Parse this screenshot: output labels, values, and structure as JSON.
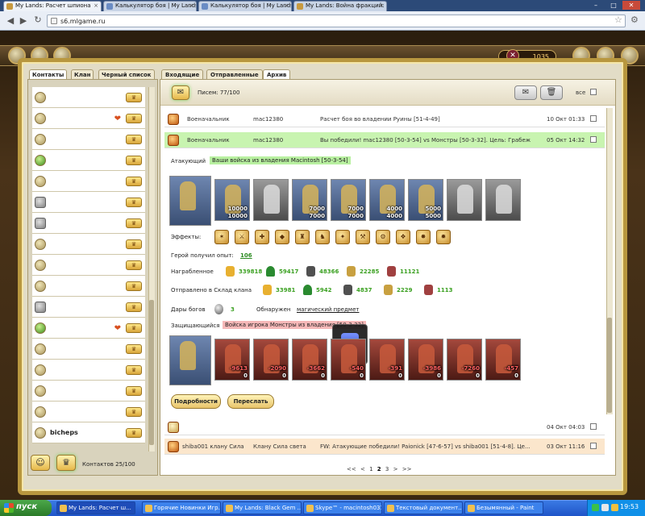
{
  "browser": {
    "tabs": [
      {
        "label": "My Lands: Расчет шпиона",
        "active": true
      },
      {
        "label": "Калькулятор боя | My Lands"
      },
      {
        "label": "Калькулятор боя | My Lands"
      },
      {
        "label": "My Lands: Война фракций: С"
      }
    ],
    "url": "s6.mlgame.ru",
    "controls": {
      "min": "–",
      "max": "□",
      "close": "✕"
    }
  },
  "game_top": {
    "resource_value": "1035"
  },
  "left_tabs": [
    "Контакты",
    "Клан",
    "Черный список"
  ],
  "contacts": [
    {
      "avatar": "plain",
      "name": "",
      "heart": false
    },
    {
      "avatar": "plain",
      "name": "",
      "heart": true
    },
    {
      "avatar": "plain",
      "name": "",
      "heart": false
    },
    {
      "avatar": "green",
      "name": "",
      "heart": false
    },
    {
      "avatar": "plain",
      "name": "",
      "heart": false
    },
    {
      "avatar": "lock",
      "name": "",
      "heart": false
    },
    {
      "avatar": "lock",
      "name": "",
      "heart": false
    },
    {
      "avatar": "plain",
      "name": "",
      "heart": false
    },
    {
      "avatar": "plain",
      "name": "",
      "heart": false
    },
    {
      "avatar": "plain",
      "name": "",
      "heart": false
    },
    {
      "avatar": "lock",
      "name": "",
      "heart": false
    },
    {
      "avatar": "green",
      "name": "",
      "heart": true
    },
    {
      "avatar": "plain",
      "name": "",
      "heart": false
    },
    {
      "avatar": "plain",
      "name": "",
      "heart": false
    },
    {
      "avatar": "plain",
      "name": "",
      "heart": false
    },
    {
      "avatar": "plain",
      "name": "",
      "heart": false
    },
    {
      "avatar": "plain",
      "name": "bicheps",
      "heart": false
    }
  ],
  "contacts_footer": {
    "count_label": "Контактов 25/100"
  },
  "right_tabs": [
    "Входящие",
    "Отправленные",
    "Архив"
  ],
  "mail_header": {
    "letters_label": "Писем: 77/100",
    "all_label": "все"
  },
  "messages": [
    {
      "type": "Военачальник",
      "author": "mac12380",
      "subject": "Расчет боя во владении Руины [51-4-49]",
      "date": "10 Окт 01:33"
    },
    {
      "type": "Военачальник",
      "author": "mac12380",
      "subject": "Вы победили! mac12380 [50-3-54] vs Монстры [50-3-32]. Цель: Грабеж",
      "date": "05 Окт 14:32"
    }
  ],
  "battle": {
    "attacker_label": "Атакующий",
    "attacker_value": "Ваши войска из владения Macintosh [50-3-54]",
    "attacker_units": [
      {
        "style": "hero",
        "n1": "",
        "n2": ""
      },
      {
        "style": "blue",
        "n1": "10000",
        "n2": "10000"
      },
      {
        "style": "gray",
        "n1": "",
        "n2": ""
      },
      {
        "style": "blue",
        "n1": "7000",
        "n2": "7000"
      },
      {
        "style": "blue",
        "n1": "7000",
        "n2": "7000"
      },
      {
        "style": "blue",
        "n1": "4000",
        "n2": "4000"
      },
      {
        "style": "blue",
        "n1": "5000",
        "n2": "5000"
      },
      {
        "style": "gray",
        "n1": "",
        "n2": ""
      },
      {
        "style": "gray",
        "n1": "",
        "n2": ""
      }
    ],
    "effects_label": "Эффекты:",
    "effects": [
      "✶",
      "⚔",
      "✚",
      "◆",
      "♜",
      "♞",
      "✦",
      "⚒",
      "⚙",
      "❖",
      "✸",
      "✹"
    ],
    "exp_label": "Герой получил опыт:",
    "exp_value": "106",
    "loot_label": "Награбленное",
    "loot": [
      "339818",
      "59417",
      "48366",
      "22285",
      "11121"
    ],
    "sent_label": "Отправлено в Склад клана",
    "sent": [
      "33981",
      "5942",
      "4837",
      "2229",
      "1113"
    ],
    "gifts_label": "Дары богов",
    "gifts_value": "3",
    "found_label": "Обнаружен",
    "found_value": "магический предмет",
    "defender_label": "Защищающийся",
    "defender_value": "Войска игрока Монстры из владения [50-3-32]",
    "defender_units": [
      {
        "style": "hero",
        "n1": "",
        "n2": ""
      },
      {
        "style": "red",
        "n1": "9613",
        "n2": "-9613",
        "n3": "0"
      },
      {
        "style": "red",
        "n1": "2090",
        "n2": "-2090",
        "n3": "0"
      },
      {
        "style": "red",
        "n1": "3662",
        "n2": "-3662",
        "n3": "0"
      },
      {
        "style": "red",
        "n1": "540",
        "n2": "-540",
        "n3": "0"
      },
      {
        "style": "red",
        "n1": "391",
        "n2": "-391",
        "n3": "0"
      },
      {
        "style": "red",
        "n1": "3986",
        "n2": "-3986",
        "n3": "0"
      },
      {
        "style": "red",
        "n1": "7260",
        "n2": "-7260",
        "n3": "0"
      },
      {
        "style": "red",
        "n1": "457",
        "n2": "-457",
        "n3": "0"
      }
    ],
    "details_button": "Подробности",
    "forward_button": "Переслать"
  },
  "messages_bottom": [
    {
      "type": "",
      "author": "",
      "subject": "",
      "date": "04 Окт 04:03"
    },
    {
      "type": "shiba001 клану Сила",
      "author": "Клану Сила света",
      "subject": "FW: Атакующие победили! Paionick [47-6-57] vs shiba001 [51-4-8]. Це...",
      "date": "03 Окт 11:16"
    }
  ],
  "pager": {
    "first": "<<",
    "prev": "<",
    "p1": "1",
    "p2": "2",
    "p3": "3",
    "next": ">",
    "last": ">>"
  },
  "taskbar": {
    "start": "пуск",
    "items": [
      {
        "label": "My Lands: Расчет ш...",
        "active": true
      },
      {
        "label": "Горячие Новинки Игр..."
      },
      {
        "label": "My Lands: Black Gem ..."
      },
      {
        "label": "Skype™ - macintosh031"
      },
      {
        "label": "Текстовый документ..."
      },
      {
        "label": "Безымянный - Paint"
      }
    ],
    "time": "19:53"
  }
}
